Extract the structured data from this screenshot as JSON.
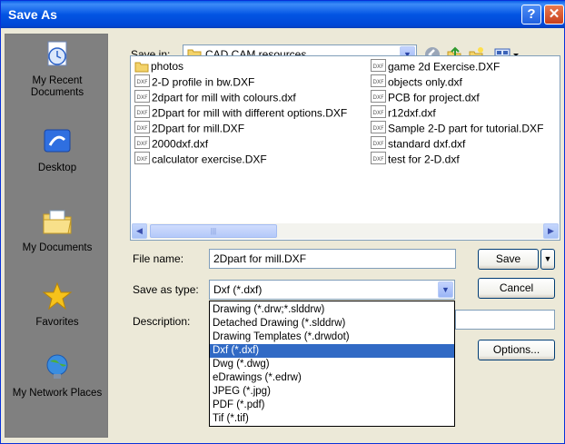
{
  "window": {
    "title": "Save As"
  },
  "places": [
    {
      "label": "My Recent Documents",
      "icon": "recent-documents-icon"
    },
    {
      "label": "Desktop",
      "icon": "desktop-icon"
    },
    {
      "label": "My Documents",
      "icon": "my-documents-icon"
    },
    {
      "label": "Favorites",
      "icon": "favorites-icon"
    },
    {
      "label": "My Network Places",
      "icon": "network-places-icon"
    }
  ],
  "save_in": {
    "label": "Save in:",
    "value": "CAD CAM resources"
  },
  "files": {
    "col1": [
      {
        "name": "photos",
        "type": "folder"
      },
      {
        "name": "2-D profile in bw.DXF",
        "type": "dxf"
      },
      {
        "name": "2dpart for mill with colours.dxf",
        "type": "dxf"
      },
      {
        "name": "2Dpart for mill with different options.DXF",
        "type": "dxf"
      },
      {
        "name": "2Dpart for mill.DXF",
        "type": "dxf"
      },
      {
        "name": "2000dxf.dxf",
        "type": "dxf"
      },
      {
        "name": "calculator exercise.DXF",
        "type": "dxf"
      }
    ],
    "col2": [
      {
        "name": "game 2d Exercise.DXF",
        "type": "dxf"
      },
      {
        "name": "objects only.dxf",
        "type": "dxf"
      },
      {
        "name": "PCB for project.dxf",
        "type": "dxf"
      },
      {
        "name": "r12dxf.dxf",
        "type": "dxf"
      },
      {
        "name": "Sample 2-D part for tutorial.DXF",
        "type": "dxf"
      },
      {
        "name": "standard dxf.dxf",
        "type": "dxf"
      },
      {
        "name": "test for 2-D.dxf",
        "type": "dxf"
      }
    ],
    "icon_badge": "DXF"
  },
  "form": {
    "file_name_label": "File name:",
    "file_name_value": "2Dpart for mill.DXF",
    "save_type_label": "Save as type:",
    "save_type_value": "Dxf (*.dxf)",
    "description_label": "Description:"
  },
  "buttons": {
    "save": "Save",
    "cancel": "Cancel",
    "options": "Options..."
  },
  "type_options": [
    "Drawing (*.drw;*.slddrw)",
    "Detached Drawing (*.slddrw)",
    "Drawing Templates (*.drwdot)",
    "Dxf (*.dxf)",
    "Dwg (*.dwg)",
    "eDrawings (*.edrw)",
    "JPEG (*.jpg)",
    "PDF (*.pdf)",
    "Tif (*.tif)"
  ],
  "selected_type_index": 3
}
